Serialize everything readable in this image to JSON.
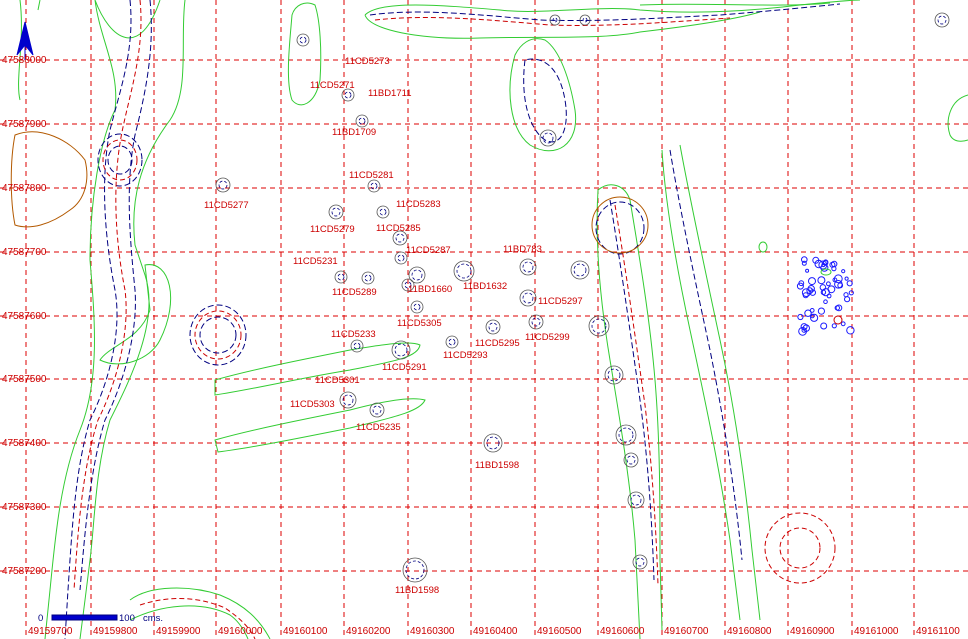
{
  "map": {
    "grid_color": "#dd0000",
    "feature_outline_color": "#33cc33",
    "contour_dark_color": "#000080",
    "contour_red_color": "#cc0000",
    "x_labels": [
      "49159700",
      "49159800",
      "49159900",
      "49160000",
      "49160100",
      "49160200",
      "49160300",
      "49160400",
      "49160500",
      "49160600",
      "49160700",
      "49160800",
      "49160900",
      "49161000",
      "49161100"
    ],
    "y_labels": [
      "47588000",
      "47587900",
      "47587800",
      "47587700",
      "47587600",
      "47587500",
      "47587400",
      "47587300",
      "47587200"
    ],
    "north_arrow_icon": "north-arrow-icon",
    "scale_bar": {
      "start": "0",
      "end": "100",
      "unit": "cms."
    },
    "features": [
      {
        "id": "11CD5273"
      },
      {
        "id": "11CD5271"
      },
      {
        "id": "11BD1711"
      },
      {
        "id": "11BD1709"
      },
      {
        "id": "11CD5277"
      },
      {
        "id": "11CD5281"
      },
      {
        "id": "11CD5283"
      },
      {
        "id": "11CD5279"
      },
      {
        "id": "11CD5285"
      },
      {
        "id": "11CD5287"
      },
      {
        "id": "11BD783"
      },
      {
        "id": "11CD5231"
      },
      {
        "id": "11CD5289"
      },
      {
        "id": "11BD1660"
      },
      {
        "id": "11BD1632"
      },
      {
        "id": "11CD5297"
      },
      {
        "id": "11CD5305"
      },
      {
        "id": "11CD5299"
      },
      {
        "id": "11CD5295"
      },
      {
        "id": "11CD5233"
      },
      {
        "id": "11CD5293"
      },
      {
        "id": "11CD5291"
      },
      {
        "id": "11CD5301"
      },
      {
        "id": "11CD5303"
      },
      {
        "id": "11CD5235"
      },
      {
        "id": "11BD1598"
      },
      {
        "id": "11BD1598"
      }
    ]
  }
}
